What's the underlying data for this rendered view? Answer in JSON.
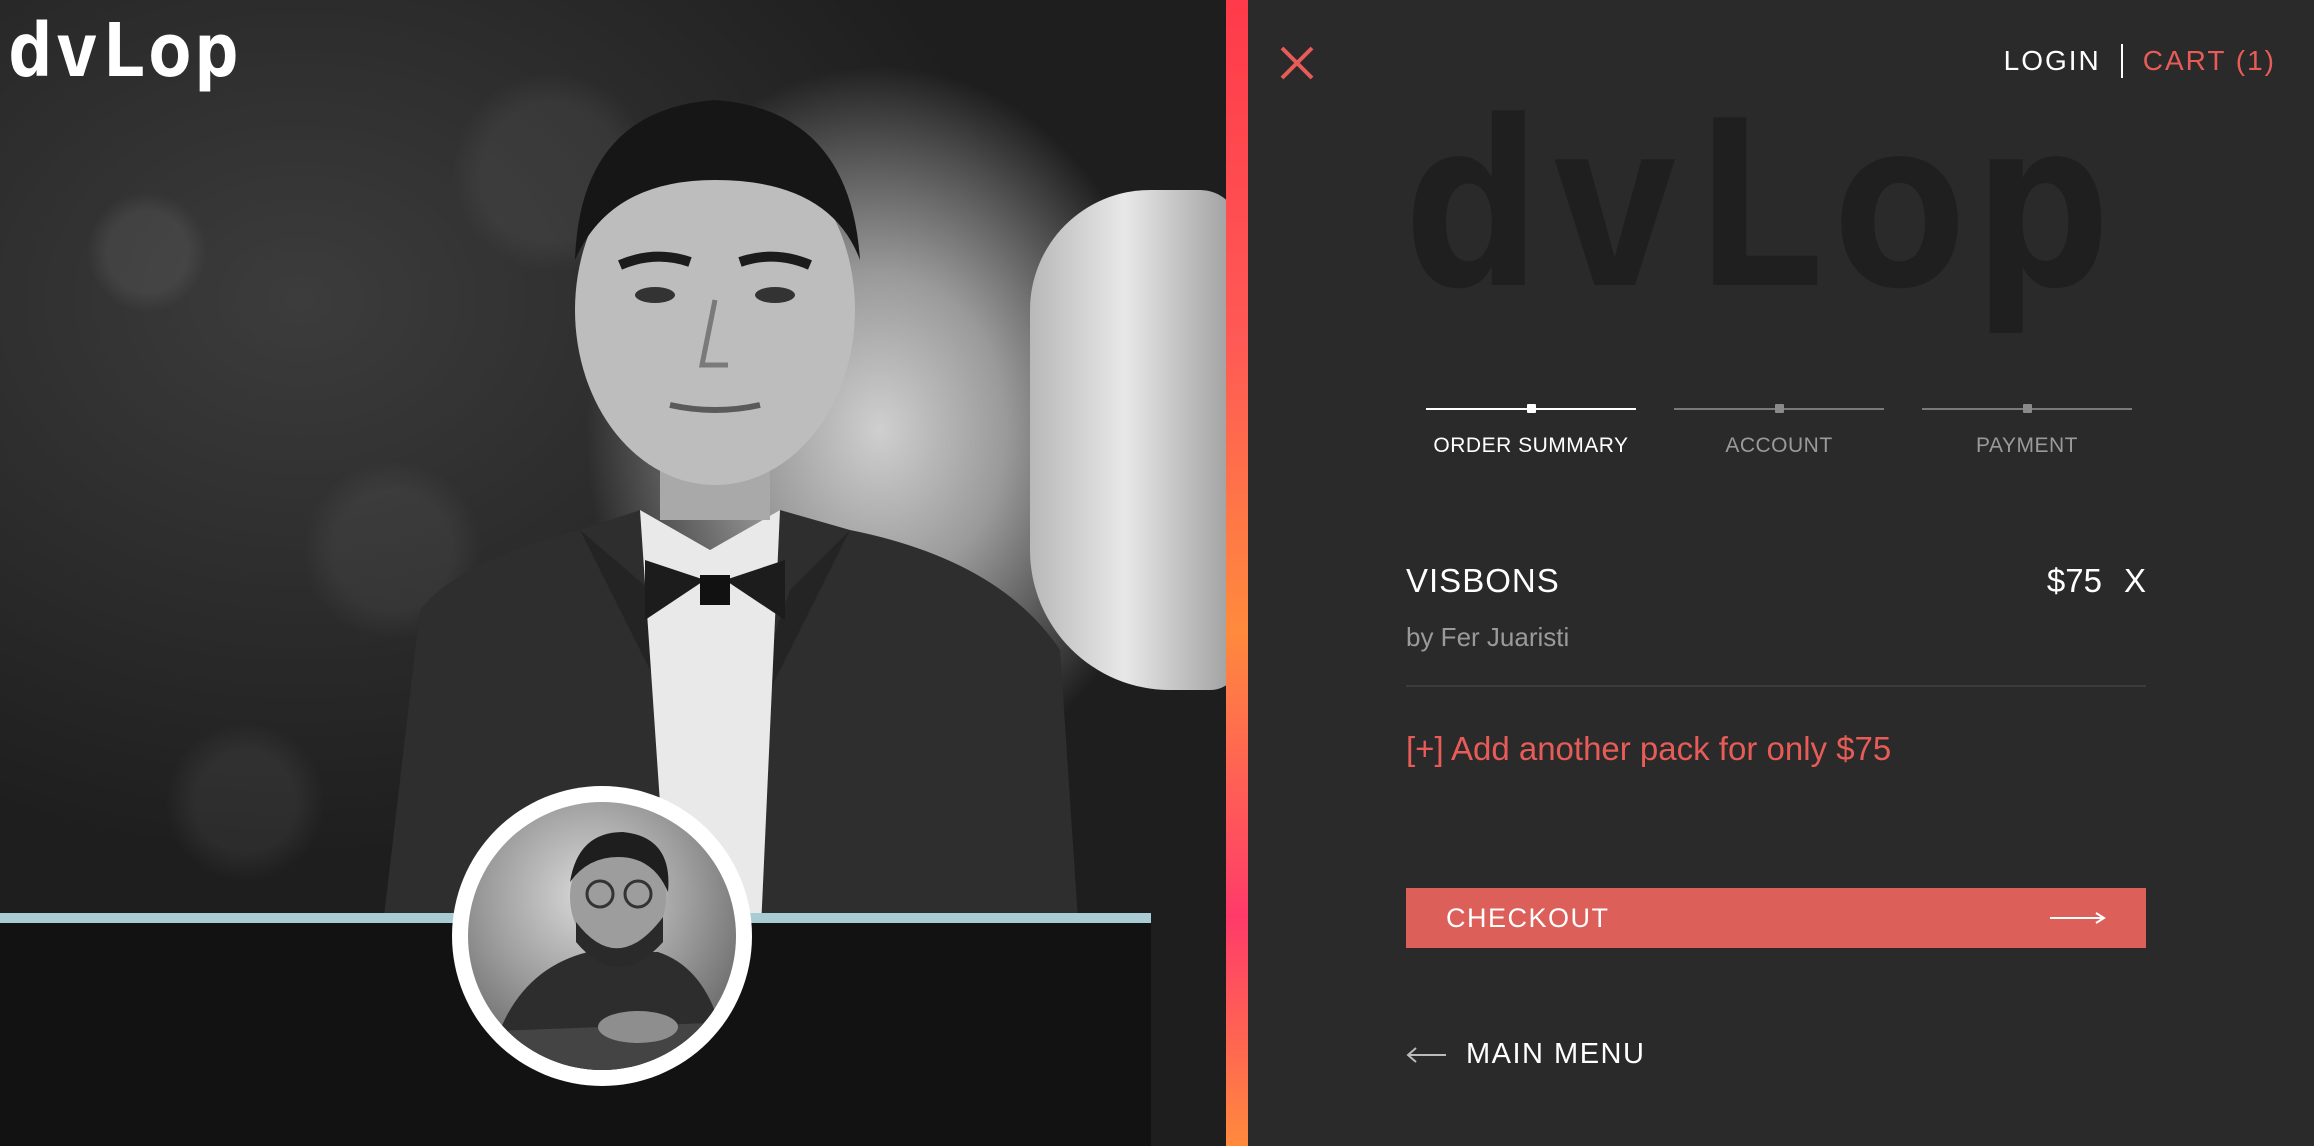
{
  "hero": {
    "brand": "dvLop"
  },
  "header": {
    "login_label": "LOGIN",
    "cart_label": "CART (1)"
  },
  "panel": {
    "brand_watermark": "dvLop"
  },
  "stepper": {
    "steps": [
      {
        "label": "ORDER SUMMARY",
        "active": true
      },
      {
        "label": "ACCOUNT",
        "active": false
      },
      {
        "label": "PAYMENT",
        "active": false
      }
    ]
  },
  "order": {
    "item_name": "VISBONS",
    "item_author": "by Fer Juaristi",
    "item_price": "$75",
    "remove_label": "X",
    "add_pack_label": "[+] Add another pack for only $75"
  },
  "actions": {
    "checkout_label": "CHECKOUT",
    "main_menu_label": "MAIN MENU"
  },
  "colors": {
    "accent": "#e85c57",
    "checkout_bg": "#dd5f5a",
    "panel_bg": "#2a2a2a",
    "hero_strip": "#a8cbd4"
  },
  "icons": {
    "close": "close-icon",
    "checkout_arrow": "arrow-right-icon",
    "back_arrow": "arrow-left-icon"
  }
}
